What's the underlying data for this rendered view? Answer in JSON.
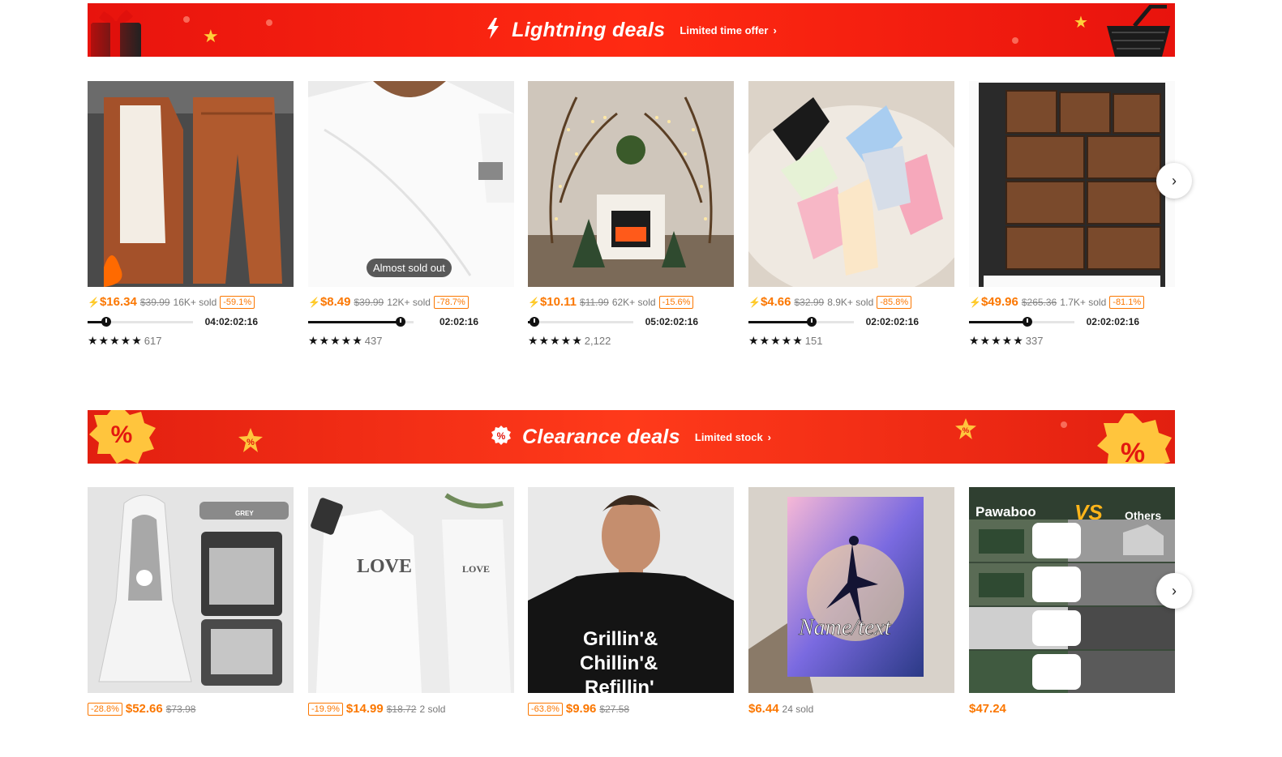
{
  "lightning": {
    "title": "Lightning deals",
    "subtitle": "Limited time offer",
    "products": [
      {
        "price": "$16.34",
        "original": "$39.99",
        "sold": "16K+ sold",
        "discount": "-59.1%",
        "progress": 0.18,
        "timer": "04:02:02:16",
        "reviews": "617",
        "stars": "★★★★★"
      },
      {
        "price": "$8.49",
        "original": "$39.99",
        "sold": "12K+ sold",
        "discount": "-78.7%",
        "progress": 0.88,
        "timer": "02:02:16",
        "reviews": "437",
        "stars": "★★★★★",
        "badge": "Almost sold out"
      },
      {
        "price": "$10.11",
        "original": "$11.99",
        "sold": "62K+ sold",
        "discount": "-15.6%",
        "progress": 0.03,
        "timer": "05:02:02:16",
        "reviews": "2,122",
        "stars": "★★★★★"
      },
      {
        "price": "$4.66",
        "original": "$32.99",
        "sold": "8.9K+ sold",
        "discount": "-85.8%",
        "progress": 0.6,
        "timer": "02:02:02:16",
        "reviews": "151",
        "stars": "★★★★★"
      },
      {
        "price": "$49.96",
        "original": "$265.36",
        "sold": "1.7K+ sold",
        "discount": "-81.1%",
        "progress": 0.55,
        "timer": "02:02:02:16",
        "reviews": "337",
        "stars": "★★★★★"
      }
    ]
  },
  "clearance": {
    "title": "Clearance deals",
    "subtitle": "Limited stock",
    "products": [
      {
        "discount": "-28.8%",
        "price": "$52.66",
        "original": "$73.98",
        "sold": ""
      },
      {
        "discount": "-19.9%",
        "price": "$14.99",
        "original": "$18.72",
        "sold": "2 sold"
      },
      {
        "discount": "-63.8%",
        "price": "$9.96",
        "original": "$27.58",
        "sold": ""
      },
      {
        "discount": "",
        "price": "$6.44",
        "original": "",
        "sold": "24 sold"
      },
      {
        "discount": "",
        "price": "$47.24",
        "original": "",
        "sold": ""
      }
    ]
  },
  "image_text": {
    "seat_tag": "GREY",
    "hoodie_text": "LOVE",
    "tshirt_lines": [
      "Grillin'&",
      "Chillin'&",
      "Refillin'"
    ],
    "blanket_text": "Name/text",
    "catio_left": "Pawaboo",
    "catio_vs": "VS",
    "catio_right": "Others"
  },
  "colors": {
    "accent": "#fb7701",
    "banner": "#f2170e"
  }
}
